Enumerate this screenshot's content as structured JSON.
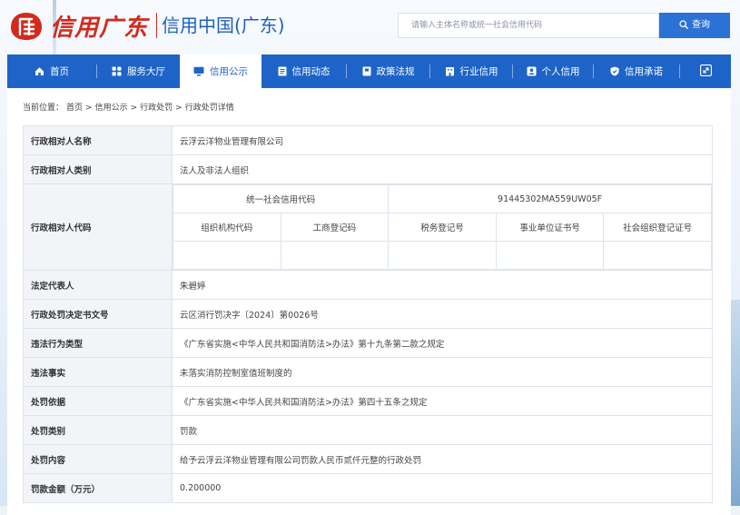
{
  "header": {
    "logo_script": "信用广东",
    "site_title": "信用中国(广东)",
    "search_placeholder": "请输入主体名称或统一社会信用代码",
    "search_button": "查询"
  },
  "nav": {
    "items": [
      {
        "label": "首页",
        "icon": "home-icon"
      },
      {
        "label": "服务大厅",
        "icon": "grid-icon"
      },
      {
        "label": "信用公示",
        "icon": "monitor-icon",
        "active": true
      },
      {
        "label": "信用动态",
        "icon": "document-icon"
      },
      {
        "label": "政策法规",
        "icon": "book-icon"
      },
      {
        "label": "行业信用",
        "icon": "building-icon"
      },
      {
        "label": "个人信用",
        "icon": "person-card-icon"
      },
      {
        "label": "信用承诺",
        "icon": "shield-check-icon"
      }
    ],
    "expand_icon": "expand-icon"
  },
  "breadcrumb": {
    "prefix": "当前位置：",
    "items": [
      "首页",
      "信用公示",
      "行政处罚",
      "行政处罚详情"
    ],
    "separator": ">"
  },
  "detail": {
    "name_label": "行政相对人名称",
    "name_value": "云浮云洋物业管理有限公司",
    "type_label": "行政相对人类别",
    "type_value": "法人及非法人组织",
    "code_label": "行政相对人代码",
    "uscc_label": "统一社会信用代码",
    "uscc_value": "91445302MA559UW05F",
    "code_headers": [
      "组织机构代码",
      "工商登记码",
      "税务登记号",
      "事业单位证书号",
      "社会组织登记证号"
    ],
    "code_values": [
      "",
      "",
      "",
      "",
      ""
    ],
    "legal_rep_label": "法定代表人",
    "legal_rep_value": "朱碧婷",
    "doc_no_label": "行政处罚决定书文号",
    "doc_no_value": "云区消行罚决字〔2024〕第0026号",
    "violation_type_label": "违法行为类型",
    "violation_type_value": "《广东省实施<中华人民共和国消防法>办法》第十九条第二款之规定",
    "violation_fact_label": "违法事实",
    "violation_fact_value": "未落实消防控制室值班制度的",
    "basis_label": "处罚依据",
    "basis_value": "《广东省实施<中华人民共和国消防法>办法》第四十五条之规定",
    "penalty_type_label": "处罚类别",
    "penalty_type_value": "罚款",
    "content_label": "处罚内容",
    "content_value": "给予云浮云洋物业管理有限公司罚款人民币贰仟元整的行政处罚",
    "amount_label": "罚款金额（万元）",
    "amount_value": "0.200000"
  },
  "colors": {
    "brand_red": "#d32a1e",
    "brand_blue": "#1e64c8",
    "search_blue": "#2a72d6"
  }
}
